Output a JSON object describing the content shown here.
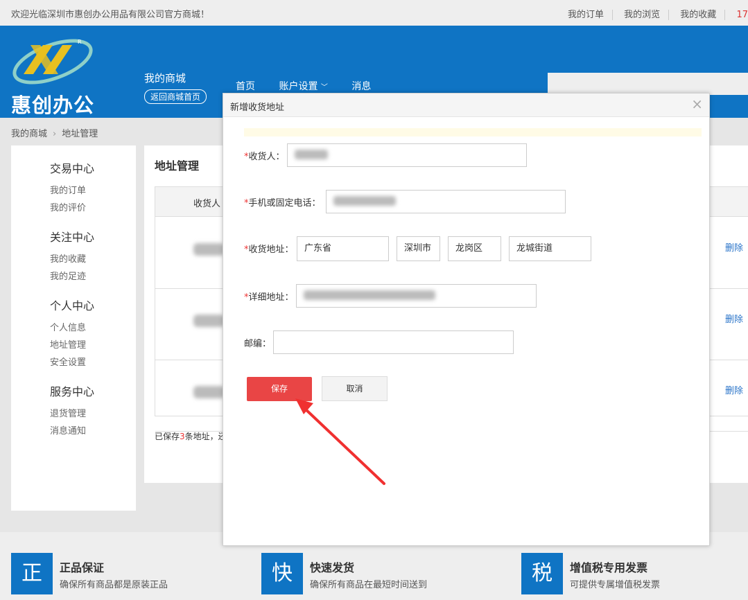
{
  "topbar": {
    "welcome": "欢迎光临深圳市惠创办公用品有限公司官方商城！",
    "links": [
      "我的订单",
      "我的浏览",
      "我的收藏"
    ],
    "extra": "17"
  },
  "header": {
    "logo_text": "惠创办公",
    "mall_title": "我的商城",
    "back_home": "返回商城首页",
    "nav": [
      "首页",
      "账户设置",
      "消息"
    ]
  },
  "breadcrumb": {
    "home": "我的商城",
    "current": "地址管理"
  },
  "sidebar": {
    "groups": [
      {
        "title": "交易中心",
        "items": [
          "我的订单",
          "我的评价"
        ]
      },
      {
        "title": "关注中心",
        "items": [
          "我的收藏",
          "我的足迹"
        ]
      },
      {
        "title": "个人中心",
        "items": [
          "个人信息",
          "地址管理",
          "安全设置"
        ]
      },
      {
        "title": "服务中心",
        "items": [
          "退货管理",
          "消息通知"
        ]
      }
    ]
  },
  "main": {
    "title": "地址管理",
    "col_receiver": "收货人",
    "delete_label": "删除",
    "saved_prefix": "已保存",
    "saved_count": "3",
    "saved_suffix": "条地址，还"
  },
  "footer": [
    {
      "icon": "正",
      "title": "正品保证",
      "desc": "确保所有商品都是原装正品"
    },
    {
      "icon": "快",
      "title": "快速发货",
      "desc": "确保所有商品在最短时间送到"
    },
    {
      "icon": "税",
      "title": "增值税专用发票",
      "desc": "可提供专属增值税发票"
    }
  ],
  "modal": {
    "title": "新增收货地址",
    "receiver_label": "收货人：",
    "phone_label": "手机或固定电话：",
    "address_label": "收货地址：",
    "province": "广东省",
    "city": "深圳市",
    "district": "龙岗区",
    "street": "龙城街道",
    "detail_label": "详细地址：",
    "zip_label": "邮编：",
    "zip_value": "",
    "save_label": "保存",
    "cancel_label": "取消"
  },
  "colors": {
    "brand_blue": "#0f74c4",
    "save_red": "#e94545",
    "arrow_red": "#f03030"
  }
}
